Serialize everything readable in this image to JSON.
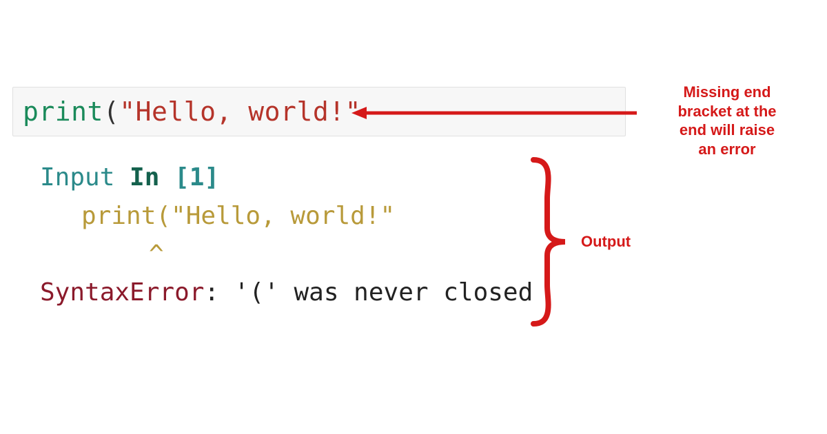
{
  "colors": {
    "annotation": "#d51919",
    "builtin": "#1a8a5a",
    "string": "#b5342a",
    "errline": "#b89a3a",
    "prompt": "#2b8a8a",
    "errname": "#8b1a2b"
  },
  "code_cell": {
    "builtin": "print",
    "paren_open": "(",
    "string": "\"Hello, world!\""
  },
  "annotation_top": {
    "line1": "Missing end",
    "line2": "bracket at the",
    "line3": "end will raise",
    "line4": "an error"
  },
  "output": {
    "row1": {
      "input": "Input ",
      "in": "In ",
      "bracket_open": "[",
      "num": "1",
      "bracket_close": "]"
    },
    "row2": "print(\"Hello, world!\"",
    "row3": "^",
    "row4": {
      "err": "SyntaxError",
      "colon": ": ",
      "msg": "'(' was never closed"
    }
  },
  "annotation_right": "Output"
}
